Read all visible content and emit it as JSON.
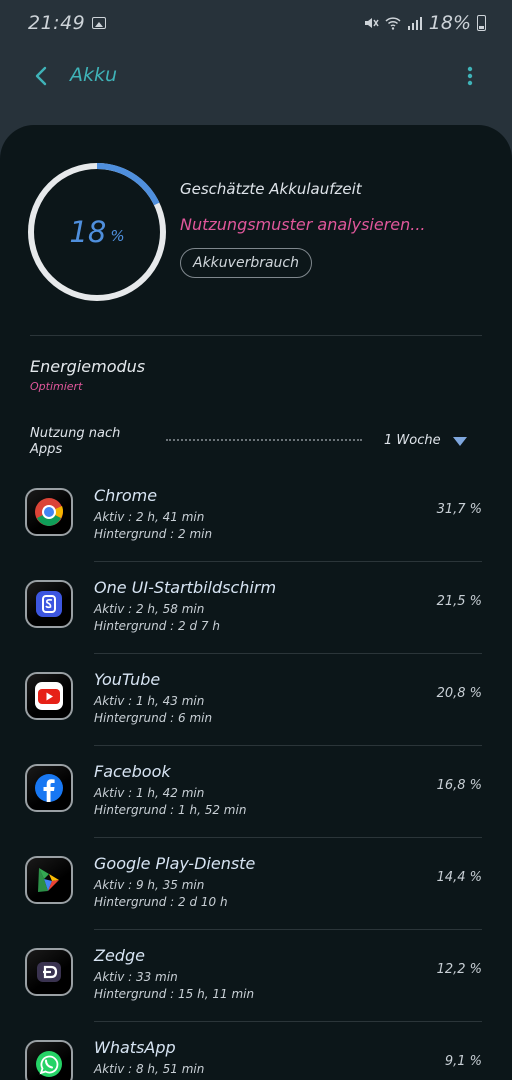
{
  "status_bar": {
    "time": "21:49",
    "battery_pct": "18%",
    "icons": [
      "image-icon",
      "mute-icon",
      "wifi-icon",
      "signal-icon",
      "battery-icon"
    ]
  },
  "app_bar": {
    "title": "Akku",
    "back_icon": "chevron-left-icon",
    "more_icon": "more-vertical-icon"
  },
  "battery": {
    "level_number": "18",
    "level_unit": "%",
    "level_fraction": 0.18,
    "estimate_label": "Geschätzte Akkulaufzeit",
    "estimate_value": "Nutzungsmuster analysieren...",
    "usage_button": "Akkuverbrauch"
  },
  "energy_mode": {
    "title": "Energiemodus",
    "value": "Optimiert"
  },
  "usage": {
    "label": "Nutzung nach Apps",
    "period": "1 Woche"
  },
  "apps": [
    {
      "name": "Chrome",
      "active": "Aktiv : 2 h, 41 min",
      "background": "Hintergrund : 2 min",
      "percent": "31,7 %",
      "icon": "chrome-icon"
    },
    {
      "name": "One UI-Startbildschirm",
      "active": "Aktiv : 2 h, 58 min",
      "background": "Hintergrund : 2 d 7 h",
      "percent": "21,5 %",
      "icon": "samsung-home-icon"
    },
    {
      "name": "YouTube",
      "active": "Aktiv : 1 h, 43 min",
      "background": "Hintergrund : 6 min",
      "percent": "20,8 %",
      "icon": "youtube-icon"
    },
    {
      "name": "Facebook",
      "active": "Aktiv : 1 h, 42 min",
      "background": "Hintergrund : 1 h, 52 min",
      "percent": "16,8 %",
      "icon": "facebook-icon"
    },
    {
      "name": "Google Play-Dienste",
      "active": "Aktiv : 9 h, 35 min",
      "background": "Hintergrund : 2 d 10 h",
      "percent": "14,4 %",
      "icon": "google-play-services-icon"
    },
    {
      "name": "Zedge",
      "active": "Aktiv : 33 min",
      "background": "Hintergrund : 15 h, 11 min",
      "percent": "12,2 %",
      "icon": "zedge-icon"
    },
    {
      "name": "WhatsApp",
      "active": "Aktiv : 8 h, 51 min",
      "background": "",
      "percent": "9,1 %",
      "icon": "whatsapp-icon"
    }
  ],
  "colors": {
    "accent_teal": "#3fb3b8",
    "accent_pink": "#e0579b",
    "ring_blue": "#4f8fdd",
    "panel_bg": "#0c1619",
    "page_bg": "#27323a"
  }
}
